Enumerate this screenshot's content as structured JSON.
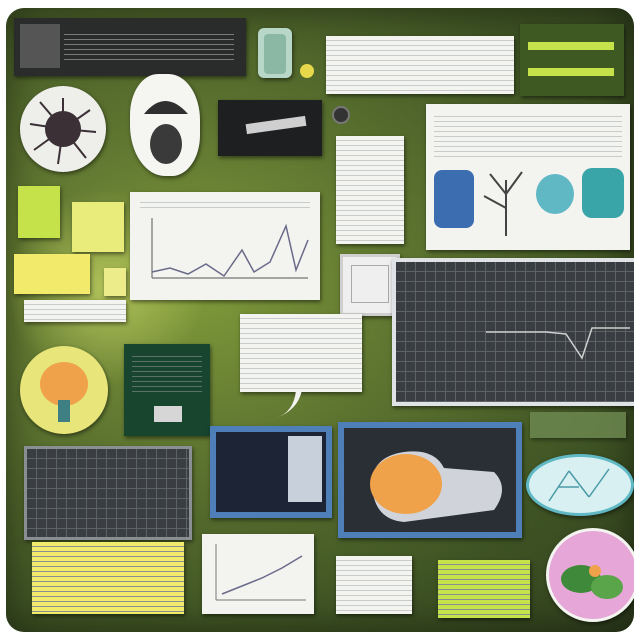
{
  "board": {
    "accent_colors": {
      "chalkboard": "#4d6428",
      "lime": "#c6e24a",
      "yellow": "#f2ea6a",
      "orange": "#f0a24a",
      "teal": "#5fb8c4",
      "blue_frame": "#4f7fb8",
      "dark_panel": "#2b2f33"
    }
  },
  "icons": {
    "microbe": "microbe-icon",
    "mushroom": "mushroom-icon",
    "orange_blob": "orange-specimen-icon",
    "tree": "tree-icon",
    "plant_photo": "plant-photo-icon",
    "jar": "jar-icon",
    "arrow": "speech-arrow-icon"
  }
}
